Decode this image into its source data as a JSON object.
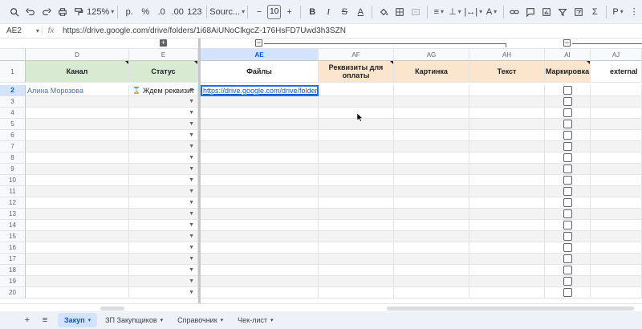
{
  "toolbar": {
    "zoom": "125%",
    "currency": "р.",
    "percent": "%",
    "dec_decrease": ".0",
    "dec_increase": ".00",
    "number_format": "123",
    "font": "Sourc...",
    "font_size": "10"
  },
  "formula_bar": {
    "cell_ref": "AE2",
    "fx": "fx",
    "content": "https://drive.google.com/drive/folders/1i68AiUNoClkgcZ-176HsFD7Uwd3h3SZN"
  },
  "columns": [
    "D",
    "E",
    "AE",
    "AF",
    "AG",
    "AH",
    "AI",
    "AJ"
  ],
  "header_row": {
    "row_number": "1",
    "cells": [
      "Канал",
      "Статус",
      "Файлы",
      "Реквизиты для оплаты",
      "Картинка",
      "Текст",
      "Маркировка",
      "external"
    ]
  },
  "row2": {
    "row_number": "2",
    "kanal": "Алина Морозова",
    "status_icon": "⌛",
    "status": "Ждем реквизит",
    "link": "https://drive.google.com/drive/folders/"
  },
  "row_numbers": [
    "3",
    "4",
    "5",
    "6",
    "7",
    "8",
    "9",
    "10",
    "11",
    "12",
    "13",
    "14",
    "15",
    "16",
    "17",
    "18",
    "19",
    "20"
  ],
  "sheets": [
    {
      "label": "Закуп",
      "active": true
    },
    {
      "label": "ЗП Закупщиков",
      "active": false
    },
    {
      "label": "Справочник",
      "active": false
    },
    {
      "label": "Чек-лист",
      "active": false
    }
  ],
  "colors": {
    "green_header": "#d9ead3",
    "peach_header": "#fce5cd",
    "selection": "#1a73e8"
  }
}
